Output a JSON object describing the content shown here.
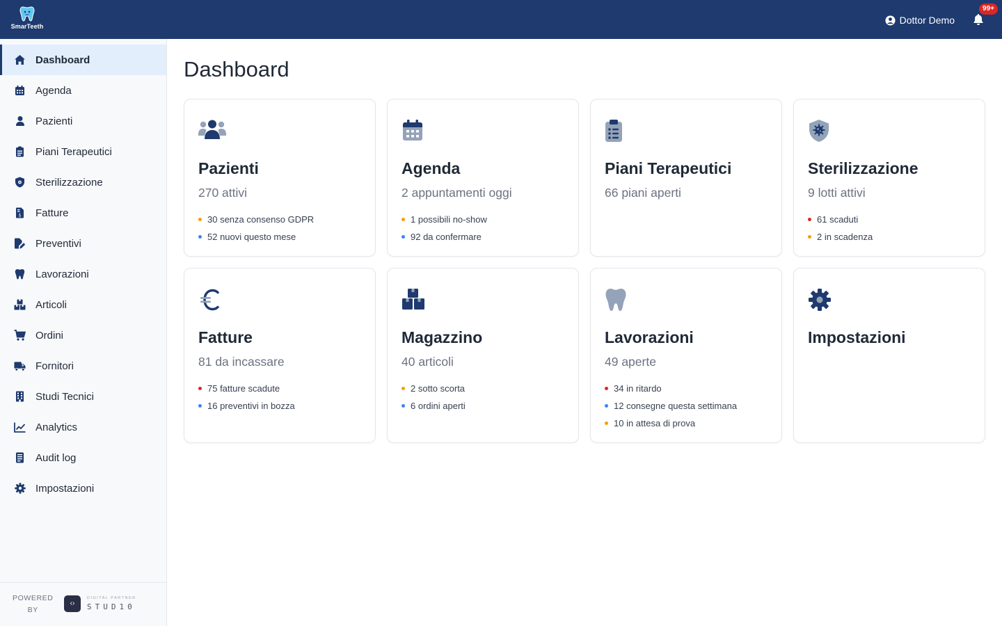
{
  "app": {
    "logo_text": "SmarTeeth"
  },
  "header": {
    "user_name": "Dottor Demo",
    "notification_badge": "99+"
  },
  "sidebar": {
    "items": [
      {
        "label": "Dashboard",
        "icon": "home-icon"
      },
      {
        "label": "Agenda",
        "icon": "calendar-icon"
      },
      {
        "label": "Pazienti",
        "icon": "user-icon"
      },
      {
        "label": "Piani Terapeutici",
        "icon": "clipboard-icon"
      },
      {
        "label": "Sterilizzazione",
        "icon": "shield-virus-icon"
      },
      {
        "label": "Fatture",
        "icon": "invoice-icon"
      },
      {
        "label": "Preventivi",
        "icon": "file-edit-icon"
      },
      {
        "label": "Lavorazioni",
        "icon": "tooth-icon"
      },
      {
        "label": "Articoli",
        "icon": "boxes-icon"
      },
      {
        "label": "Ordini",
        "icon": "cart-icon"
      },
      {
        "label": "Fornitori",
        "icon": "truck-icon"
      },
      {
        "label": "Studi Tecnici",
        "icon": "building-icon"
      },
      {
        "label": "Analytics",
        "icon": "chart-line-icon"
      },
      {
        "label": "Audit log",
        "icon": "log-icon"
      },
      {
        "label": "Impostazioni",
        "icon": "gear-icon"
      }
    ],
    "powered_by": {
      "line1": "POWERED",
      "line2": "BY",
      "partner_label": "DIGITAL PARTNER",
      "partner_name": "STUD10",
      "partner_glyph": "‹›"
    }
  },
  "main": {
    "title": "Dashboard",
    "cards": [
      {
        "title": "Pazienti",
        "subtitle": "270 attivi",
        "icon": "users-icon",
        "items": [
          {
            "text": "30 senza consenso GDPR",
            "color": "#f59e0b"
          },
          {
            "text": "52 nuovi questo mese",
            "color": "#3b82f6"
          }
        ]
      },
      {
        "title": "Agenda",
        "subtitle": "2 appuntamenti oggi",
        "icon": "calendar-icon",
        "items": [
          {
            "text": "1 possibili no-show",
            "color": "#f59e0b"
          },
          {
            "text": "92 da confermare",
            "color": "#3b82f6"
          }
        ]
      },
      {
        "title": "Piani Terapeutici",
        "subtitle": "66 piani aperti",
        "icon": "clipboard-list-icon",
        "items": []
      },
      {
        "title": "Sterilizzazione",
        "subtitle": "9 lotti attivi",
        "icon": "shield-virus-icon",
        "items": [
          {
            "text": "61 scaduti",
            "color": "#dc2626"
          },
          {
            "text": "2 in scadenza",
            "color": "#f59e0b"
          }
        ]
      },
      {
        "title": "Fatture",
        "subtitle": "81 da incassare",
        "icon": "euro-icon",
        "items": [
          {
            "text": "75 fatture scadute",
            "color": "#dc2626"
          },
          {
            "text": "16 preventivi in bozza",
            "color": "#3b82f6"
          }
        ]
      },
      {
        "title": "Magazzino",
        "subtitle": "40 articoli",
        "icon": "boxes-icon",
        "items": [
          {
            "text": "2 sotto scorta",
            "color": "#f59e0b"
          },
          {
            "text": "6 ordini aperti",
            "color": "#3b82f6"
          }
        ]
      },
      {
        "title": "Lavorazioni",
        "subtitle": "49 aperte",
        "icon": "tooth-icon",
        "items": [
          {
            "text": "34 in ritardo",
            "color": "#dc2626"
          },
          {
            "text": "12 consegne questa settimana",
            "color": "#3b82f6"
          },
          {
            "text": "10 in attesa di prova",
            "color": "#f59e0b"
          }
        ]
      },
      {
        "title": "Impostazioni",
        "subtitle": "",
        "icon": "gear-icon",
        "items": []
      }
    ]
  },
  "colors": {
    "header_bg": "#1e3a6e",
    "icon_dark": "#1e3a6e",
    "icon_light": "#94a3b8",
    "active_bg": "#e3eefc"
  }
}
